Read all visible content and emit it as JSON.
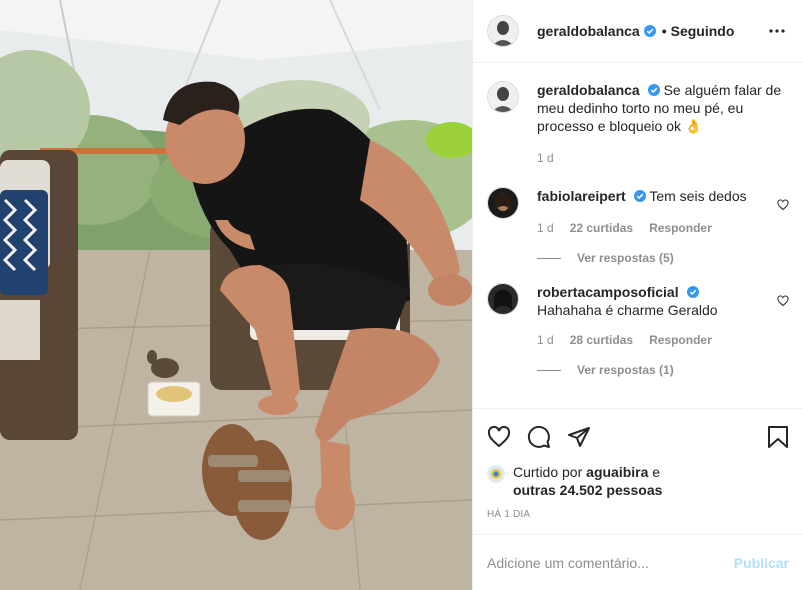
{
  "post": {
    "author": "geraldobalanca",
    "follow_state": "Seguindo",
    "separator": "•",
    "more_icon": "more-horizontal-icon",
    "verified_icon": "verified-badge-icon"
  },
  "caption": {
    "user": "geraldobalanca",
    "text": "Se alguém falar de meu dedinho torto no meu pé, eu processo e bloqueio ok 👌",
    "time": "1 d"
  },
  "comments": [
    {
      "user": "fabiolareipert",
      "text": "Tem seis dedos",
      "time": "1 d",
      "likes": "22 curtidas",
      "reply_label": "Responder",
      "view_replies": "Ver respostas (5)"
    },
    {
      "user": "robertacamposoficial",
      "text": "Hahahaha é charme Geraldo",
      "time": "1 d",
      "likes": "28 curtidas",
      "reply_label": "Responder",
      "view_replies": "Ver respostas (1)"
    }
  ],
  "actions": {
    "like_icon": "heart-icon",
    "comment_icon": "comment-icon",
    "share_icon": "paper-plane-icon",
    "save_icon": "bookmark-icon"
  },
  "likes": {
    "prefix": "Curtido por",
    "user": "aguaibira",
    "connector": "e",
    "others": "outras 24.502 pessoas"
  },
  "timestamp": "HÁ 1 DIA",
  "add_comment": {
    "placeholder": "Adicione um comentário...",
    "publish_label": "Publicar"
  },
  "colors": {
    "verified_blue": "#3897f0",
    "publish_disabled": "#b2dffc",
    "meta_gray": "#8e8e8e"
  }
}
